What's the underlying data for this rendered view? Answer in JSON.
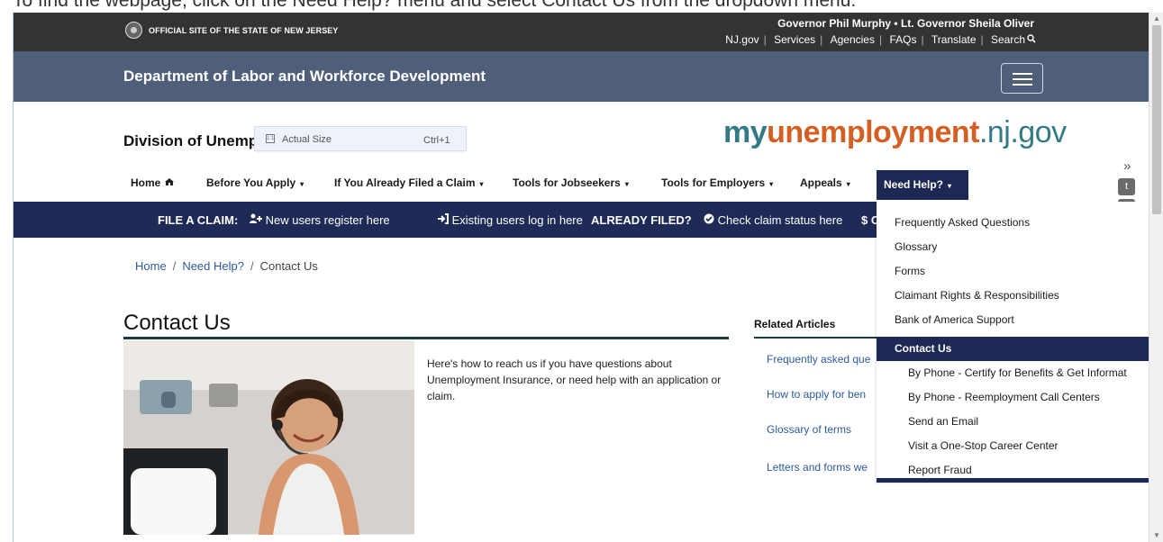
{
  "top_caption": "To find the webpage, click on the Need Help? menu and select Contact Us from the dropdown menu.",
  "site": {
    "official_label": "OFFICIAL SITE OF THE STATE OF NEW JERSEY",
    "governor": "Governor Phil Murphy • Lt. Governor Sheila Oliver",
    "links": [
      "NJ.gov",
      "Services",
      "Agencies",
      "FAQs",
      "Translate",
      "Search"
    ]
  },
  "department": "Department of Labor and Workforce Development",
  "division": "Division of Unemployment Insurance",
  "tooltip": {
    "label": "Actual Size",
    "shortcut": "Ctrl+1"
  },
  "brand": {
    "my": "my",
    "main": "unemployment",
    "suffix": ".nj.gov"
  },
  "nav": {
    "items": [
      "Home",
      "Before You Apply",
      "If You Already Filed a Claim",
      "Tools for Jobseekers",
      "Tools for Employers",
      "Appeals"
    ],
    "active": "Need Help?"
  },
  "claim_bar": {
    "file_label": "FILE A CLAIM:",
    "new_users": "New users register here",
    "existing_users": "Existing users log in here",
    "already_filed": "ALREADY FILED?",
    "check_status": "Check claim status here",
    "cert_partial": "$ Cer"
  },
  "breadcrumb": [
    "Home",
    "Need Help?",
    "Contact Us"
  ],
  "page_title": "Contact Us",
  "intro": "Here's how to reach us if you have questions about Unemployment Insurance, or need help with an application or claim.",
  "related": {
    "title": "Related Articles",
    "links": [
      "Frequently asked que",
      "How to apply for ben",
      "Glossary of terms",
      "Letters and forms we"
    ]
  },
  "dropdown": {
    "items": [
      "Frequently Asked Questions",
      "Glossary",
      "Forms",
      "Claimant Rights & Responsibilities",
      "Bank of America Support",
      "Contact Us",
      "By Phone - Certify for Benefits & Get Informat",
      "By Phone - Reemployment Call Centers",
      "Send an Email",
      "Visit a One-Stop Career Center",
      "Report Fraud"
    ]
  },
  "icons": {
    "home": "home-icon",
    "user_plus": "user-plus-icon",
    "login": "login-icon",
    "check_circle": "check-circle-icon",
    "twitter": "twitter-icon"
  },
  "colors": {
    "top_bar": "#333333",
    "department_bar": "#4f5f7a",
    "navy": "#1d2855",
    "link": "#2c5aa0",
    "brand_teal": "#337a86",
    "brand_orange": "#d55f23"
  }
}
